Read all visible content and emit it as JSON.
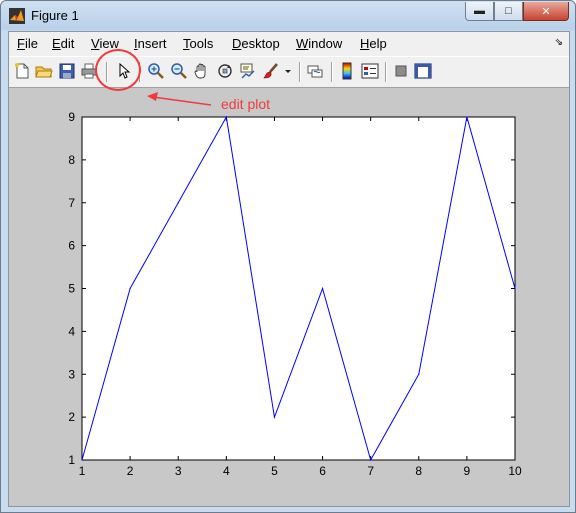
{
  "window": {
    "title": "Figure 1"
  },
  "menu": [
    "File",
    "Edit",
    "View",
    "Insert",
    "Tools",
    "Desktop",
    "Window",
    "Help"
  ],
  "menu_accel": [
    "F",
    "E",
    "V",
    "I",
    "T",
    "D",
    "W",
    "H"
  ],
  "toolbar": {
    "icons": [
      "new-figure-icon",
      "open-file-icon",
      "save-icon",
      "print-icon",
      "edit-plot-icon",
      "zoom-in-icon",
      "zoom-out-icon",
      "pan-icon",
      "rotate-3d-icon",
      "data-cursor-icon",
      "brush-icon",
      "brush-dropdown-icon",
      "link-plot-icon",
      "colorbar-icon",
      "legend-icon",
      "hide-plot-tools-icon",
      "show-plot-tools-icon"
    ]
  },
  "annotation": {
    "text": "edit plot",
    "color": "#ef3b3b"
  },
  "chart_data": {
    "type": "line",
    "x": [
      1,
      2,
      3,
      4,
      5,
      6,
      7,
      8,
      9,
      10
    ],
    "y": [
      1,
      5,
      7,
      9,
      2,
      5,
      1,
      3,
      9,
      5
    ],
    "xlim": [
      1,
      10
    ],
    "ylim": [
      1,
      9
    ],
    "xticks": [
      1,
      2,
      3,
      4,
      5,
      6,
      7,
      8,
      9,
      10
    ],
    "yticks": [
      1,
      2,
      3,
      4,
      5,
      6,
      7,
      8,
      9
    ],
    "line_color": "#0000ff",
    "grid": false,
    "title": "",
    "xlabel": "",
    "ylabel": ""
  }
}
